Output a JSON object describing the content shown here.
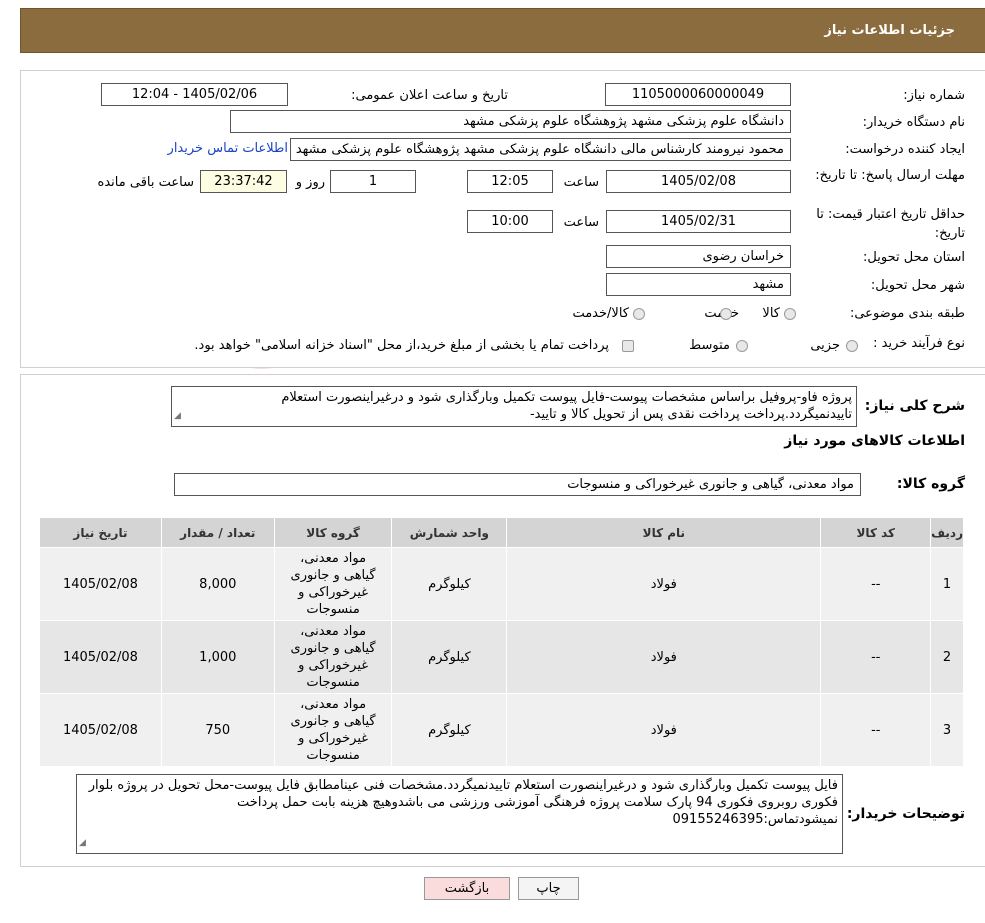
{
  "header": {
    "title": "جزئیات اطلاعات نیاز"
  },
  "form": {
    "need_number": {
      "label": "شماره نیاز:",
      "value": "1105000060000049"
    },
    "announce_datetime": {
      "label": "تاریخ و ساعت اعلان عمومی:",
      "value": "1405/02/06 - 12:04"
    },
    "buyer_org": {
      "label": "نام دستگاه خریدار:",
      "value": "دانشگاه علوم پزشکی مشهد   پژوهشگاه علوم پزشکی مشهد"
    },
    "creator": {
      "label": "ایجاد کننده درخواست:",
      "value": "محمود نیرومند کارشناس مالی دانشگاه علوم پزشکی مشهد   پژوهشگاه علوم پزشکی مشهد",
      "contact_link": "اطلاعات تماس خریدار"
    },
    "reply_deadline": {
      "label": "مهلت ارسال پاسخ: تا تاریخ:",
      "date": "1405/02/08",
      "time_label": "ساعت",
      "time": "12:05",
      "days": "1",
      "days_label": "روز و",
      "remaining": "23:37:42",
      "remaining_label": "ساعت باقی مانده"
    },
    "price_validity": {
      "label": "حداقل تاریخ اعتبار قیمت: تا تاریخ:",
      "date": "1405/02/31",
      "time_label": "ساعت",
      "time": "10:00"
    },
    "province": {
      "label": "استان محل تحویل:",
      "value": "خراسان رضوی"
    },
    "city": {
      "label": "شهر محل تحویل:",
      "value": "مشهد"
    },
    "category": {
      "label": "طبقه بندی موضوعی:",
      "options": [
        "کالا",
        "خدمت",
        "کالا/خدمت"
      ]
    },
    "purchase_type": {
      "label": "نوع فرآیند خرید :",
      "options": [
        "جزیی",
        "متوسط"
      ],
      "note": "پرداخت تمام یا بخشی از مبلغ خرید،از محل \"اسناد خزانه اسلامی\" خواهد بود."
    }
  },
  "summary": {
    "label": "شرح کلی نیاز:",
    "text": "پروژه فاو-پروفیل براساس مشخصات پیوست-فایل پیوست تکمیل وبارگذاری شود و درغیراینصورت استعلام تاییدنمیگردد.پرداخت پرداخت نقدی پس از تحویل کالا و تایید-"
  },
  "goods_section": {
    "title": "اطلاعات کالاهای مورد نیاز",
    "group_label": "گروه کالا:",
    "group_value": "مواد معدنی، گیاهی و جانوری غیرخوراکی و منسوجات"
  },
  "table": {
    "headers": [
      "ردیف",
      "کد کالا",
      "نام کالا",
      "واحد شمارش",
      "گروه کالا",
      "تعداد / مقدار",
      "تاریخ نیاز"
    ],
    "rows": [
      {
        "row": "1",
        "code": "--",
        "name": "فولاد",
        "unit": "کیلوگرم",
        "group_lines": [
          "مواد معدنی،",
          "گیاهی و جانوری",
          "غیرخوراکی و",
          "منسوجات"
        ],
        "qty": "8,000",
        "date": "1405/02/08"
      },
      {
        "row": "2",
        "code": "--",
        "name": "فولاد",
        "unit": "کیلوگرم",
        "group_lines": [
          "مواد معدنی،",
          "گیاهی و جانوری",
          "غیرخوراکی و",
          "منسوجات"
        ],
        "qty": "1,000",
        "date": "1405/02/08"
      },
      {
        "row": "3",
        "code": "--",
        "name": "فولاد",
        "unit": "کیلوگرم",
        "group_lines": [
          "مواد معدنی،",
          "گیاهی و جانوری",
          "غیرخوراکی و",
          "منسوجات"
        ],
        "qty": "750",
        "date": "1405/02/08"
      }
    ]
  },
  "buyer_notes": {
    "label": "توضیحات خریدار:",
    "text": "فایل پیوست تکمیل وبارگذاری شود و درغیراینصورت استعلام تاییدنمیگردد.مشخصات فنی عینامطابق فایل پیوست-محل تحویل در پروژه بلوار فکوری روبروی فکوری 94 پارک سلامت پروژه فرهنگی آموزشی ورزشی می باشدوهیچ هزینه بابت حمل پرداخت نمیشودتماس:09155246395"
  },
  "buttons": {
    "print": "چاپ",
    "back": "بازگشت"
  },
  "watermark": {
    "text": "AriaTender.neT"
  },
  "colors": {
    "header_bg": "#8b6c3e",
    "link": "#1a44c8",
    "back_btn_bg": "#fbdcdc"
  }
}
